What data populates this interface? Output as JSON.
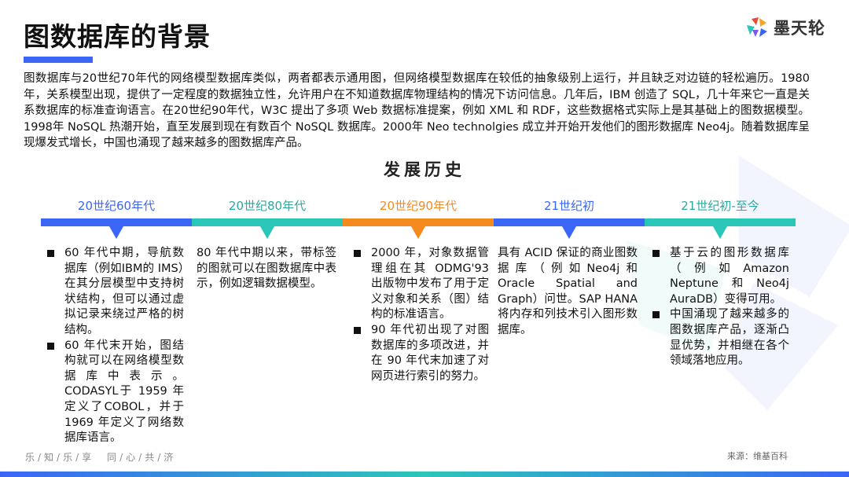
{
  "header": {
    "title": "图数据库的背景",
    "logo_text": "墨天轮"
  },
  "intro": "图数据库与20世纪70年代的网络模型数据库类似，两者都表示通用图，但网络模型数据库在较低的抽象级别上运行，并且缺乏对边链的轻松遍历。1980年，关系模型出现，提供了一定程度的数据独立性，允许用户在不知道数据库物理结构的情况下访问信息。几年后，IBM 创造了 SQL，几十年来它一直是关系数据库的标准查询语言。在20世纪90年代，W3C 提出了多项 Web 数据标准提案，例如 XML 和 RDF，这些数据格式实际上是其基础上的图数据模型。1998年 NoSQL 热潮开始，直至发展到现在有数百个 NoSQL 数据库。2000年 Neo technolgies 成立并开始开发他们的图形数据库 Neo4j。随着数据库呈现爆发式增长，中国也涌现了越来越多的图数据库产品。",
  "timeline": {
    "title": "发展历史",
    "eras": [
      {
        "label": "20世纪60年代",
        "color": "#3b66f5",
        "label_color": "#3b66f5"
      },
      {
        "label": "20世纪80年代",
        "color": "#2cc6b9",
        "label_color": "#2aa99f"
      },
      {
        "label": "20世纪90年代",
        "color": "#f58a1f",
        "label_color": "#f58a1f"
      },
      {
        "label": "21世纪初",
        "color": "#3b66f5",
        "label_color": "#3b66f5"
      },
      {
        "label": "21世纪初-至今",
        "color": "#2cc6b9",
        "label_color": "#2aa99f"
      }
    ]
  },
  "columns": {
    "c1": {
      "items": [
        "60 年代中期，导航数据库（例如IBM的 IMS）在其分层模型中支持树状结构，但可以通过虚拟记录来绕过严格的树结构。",
        "60 年代末开始，图结构就可以在网络模型数据库中表示。CODASYL于 1959 年定义了COBOL，并于 1969 年定义了网络数据库语言。"
      ]
    },
    "c2": {
      "text": "80 年代中期以来，带标签的图就可以在图数据库中表示，例如逻辑数据模型。"
    },
    "c3": {
      "items": [
        "2000 年，对象数据管理组在其 ODMG'93 出版物中发布了用于定义对象和关系（图）结构的标准语言。",
        "90 年代初出现了对图数据库的多项改进，并在 90 年代末加速了对网页进行索引的努力。"
      ]
    },
    "c4": {
      "text": "具有 ACID 保证的商业图数据库（例如Neo4j和 Oracle Spatial and Graph）问世。SAP HANA将内存和列技术引入图形数据库。"
    },
    "c5": {
      "items": [
        "基于云的图形数据库（例如Amazon Neptune和Neo4j AuraDB）变得可用。",
        "中国涌现了越来越多的图数据库产品，逐渐凸显优势，并相继在各个领域落地应用。"
      ]
    }
  },
  "footer": {
    "slogan": "乐/知/乐/享　同/心/共/济",
    "source": "来源：维基百科"
  }
}
